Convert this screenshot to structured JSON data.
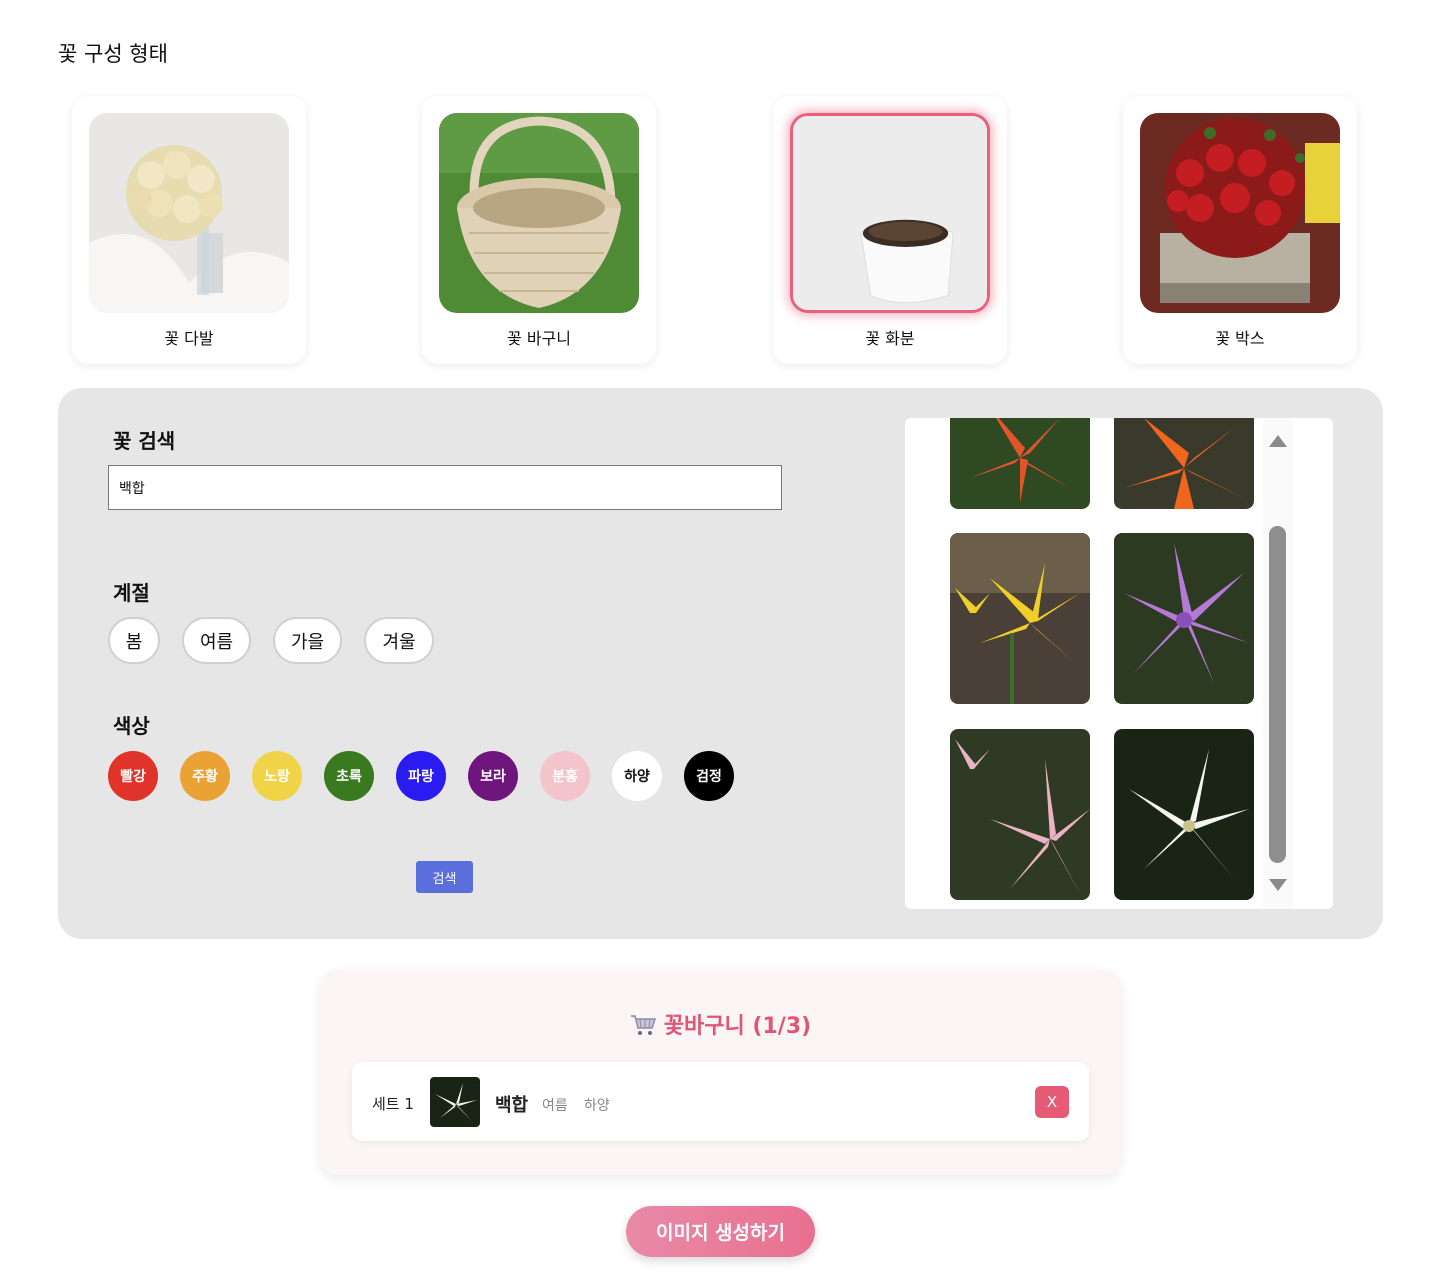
{
  "form_section": {
    "title": "꽃 구성 형태",
    "types": [
      {
        "label": "꽃 다발",
        "image": "rose-bouquet",
        "selected": false
      },
      {
        "label": "꽃 바구니",
        "image": "wicker-basket",
        "selected": false
      },
      {
        "label": "꽃 화분",
        "image": "white-pot",
        "selected": true
      },
      {
        "label": "꽃 박스",
        "image": "rose-box",
        "selected": false
      }
    ]
  },
  "search_panel": {
    "search_label": "꽃 검색",
    "search_value": "백합",
    "season_label": "계절",
    "seasons": [
      "봄",
      "여름",
      "가을",
      "겨울"
    ],
    "color_label": "색상",
    "colors": [
      {
        "label": "빨강",
        "hex": "#e0332a"
      },
      {
        "label": "주황",
        "hex": "#eba234"
      },
      {
        "label": "노랑",
        "hex": "#f1d347"
      },
      {
        "label": "초록",
        "hex": "#3a7a1f"
      },
      {
        "label": "파랑",
        "hex": "#2a1cf0"
      },
      {
        "label": "보라",
        "hex": "#6e157e"
      },
      {
        "label": "분홍",
        "hex": "#f3c4cc"
      },
      {
        "label": "하양",
        "hex": "#ffffff"
      },
      {
        "label": "검정",
        "hex": "#000000"
      }
    ],
    "search_button": "검색"
  },
  "results": [
    {
      "image": "orange-lily-1"
    },
    {
      "image": "orange-lily-2"
    },
    {
      "image": "yellow-lily"
    },
    {
      "image": "purple-lily"
    },
    {
      "image": "pink-lily"
    },
    {
      "image": "white-lily"
    }
  ],
  "cart": {
    "icon": "cart-icon",
    "title": "꽃바구니 (1/3)",
    "items": [
      {
        "set": "세트 1",
        "name": "백합",
        "season": "여름",
        "color": "하양",
        "remove": "X",
        "image": "white-lily"
      }
    ]
  },
  "generate_button": "이미지 생성하기",
  "accent_colors": {
    "pink": "#e05574",
    "search_button": "#5a6fdc",
    "selected_border": "#e8607a"
  }
}
